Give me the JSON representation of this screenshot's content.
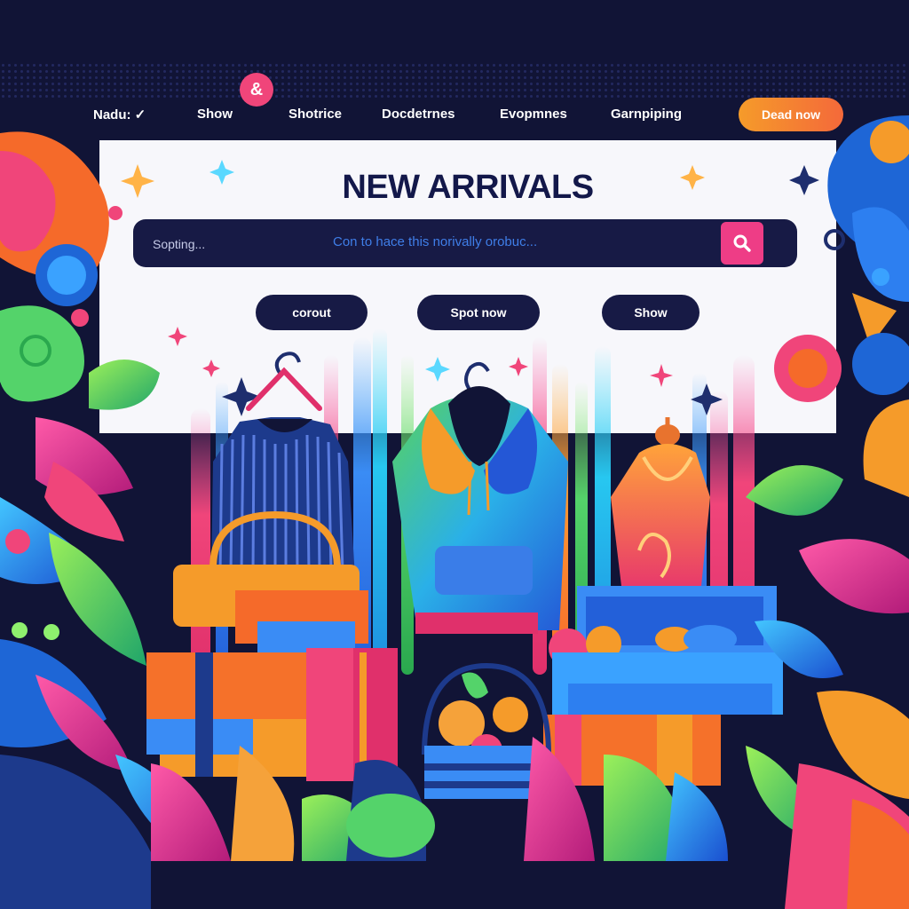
{
  "nav": {
    "logo_glyph": "&",
    "links": [
      "Nadu: ✓",
      "Show",
      "Shotrice",
      "Docdetrnes",
      "Evopmnes",
      "Garnpiping"
    ],
    "cta_label": "Dead now"
  },
  "hero": {
    "title": "NEW ARRIVALS",
    "search": {
      "placeholder": "Sopting...",
      "hint": "Con to hace this norivally orobuc..."
    },
    "buttons": [
      "corout",
      "Spot now",
      "Show"
    ]
  },
  "colors": {
    "background": "#111436",
    "panel": "#f7f7fb",
    "accent_pink": "#ee3d86",
    "accent_orange": "#f59b2a",
    "navy": "#171a45",
    "hint_blue": "#3f7ee8"
  },
  "icons": [
    "search-icon",
    "hanger-icon",
    "sparkle-icon"
  ]
}
